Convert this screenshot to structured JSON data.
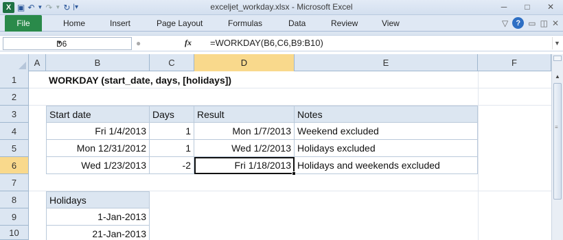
{
  "window": {
    "title": "exceljet_workday.xlsx - Microsoft Excel",
    "app_icon": "excel-x-icon"
  },
  "ribbon": {
    "file_tab": "File",
    "tabs": [
      "Home",
      "Insert",
      "Page Layout",
      "Formulas",
      "Data",
      "Review",
      "View"
    ]
  },
  "formula_bar": {
    "name_box": "D6",
    "fx_label": "fx",
    "formula": "=WORKDAY(B6,C6,B9:B10)"
  },
  "columns": [
    "A",
    "B",
    "C",
    "D",
    "E",
    "F"
  ],
  "selected_column": "D",
  "rows": [
    "1",
    "2",
    "3",
    "4",
    "5",
    "6",
    "7",
    "8",
    "9",
    "10"
  ],
  "selected_row": "6",
  "sheet": {
    "title": "WORKDAY (start_date, days, [holidays])",
    "table_headers": [
      "Start date",
      "Days",
      "Result",
      "Notes"
    ],
    "table_rows": [
      [
        "Fri 1/4/2013",
        "1",
        "Mon 1/7/2013",
        "Weekend excluded"
      ],
      [
        "Mon 12/31/2012",
        "1",
        "Wed 1/2/2013",
        "Holidays excluded"
      ],
      [
        "Wed 1/23/2013",
        "-2",
        "Fri 1/18/2013",
        "Holidays and weekends excluded"
      ]
    ],
    "holidays_header": "Holidays",
    "holidays": [
      "1-Jan-2013",
      "21-Jan-2013"
    ]
  },
  "colors": {
    "file_tab": "#2a8a4a",
    "header_fill": "#dce6f1",
    "selected_header": "#f9d98c"
  }
}
